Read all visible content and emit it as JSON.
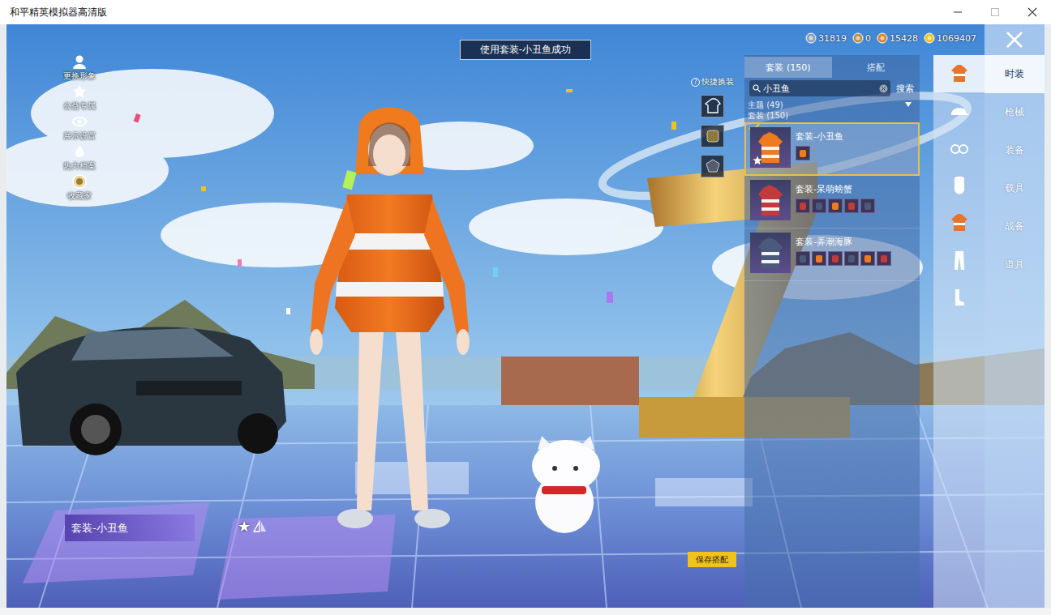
{
  "window": {
    "title": "和平精英模拟器高清版"
  },
  "toast": "使用套装-小丑鱼成功",
  "side_menu": [
    {
      "label": "更换形象"
    },
    {
      "label": "公益专属"
    },
    {
      "label": "展示设置"
    },
    {
      "label": "热力档案"
    },
    {
      "label": "收藏家"
    }
  ],
  "currencies": [
    {
      "amount": "31819",
      "color": "#8fa3bd"
    },
    {
      "amount": "0",
      "color": "#b8934a"
    },
    {
      "amount": "15428",
      "color": "#d98a2b"
    },
    {
      "amount": "1069407",
      "color": "#f0c419"
    }
  ],
  "quick_change": {
    "help": "?",
    "label": "快捷换装"
  },
  "suit_panel": {
    "tabs": [
      {
        "label": "套装 (150)",
        "selected": true
      },
      {
        "label": "搭配",
        "selected": false
      }
    ],
    "search": {
      "value": "小丑鱼",
      "button": "搜索"
    },
    "filters": [
      "主题 (49)",
      "套装 (150)"
    ],
    "items": [
      {
        "name": "套装-小丑鱼",
        "selected": true,
        "favorite": true,
        "pieces": 1
      },
      {
        "name": "套装-呆萌螃蟹",
        "selected": false,
        "favorite": false,
        "pieces": 5
      },
      {
        "name": "套装-弄潮海豚",
        "selected": false,
        "favorite": false,
        "pieces": 6
      }
    ]
  },
  "categories": [
    {
      "selected": true
    },
    {
      "selected": false
    },
    {
      "selected": false
    },
    {
      "selected": false
    },
    {
      "selected": false
    },
    {
      "selected": false
    },
    {
      "selected": false
    }
  ],
  "main_tabs": [
    {
      "label": "时装",
      "selected": true
    },
    {
      "label": "枪械",
      "selected": false
    },
    {
      "label": "装备",
      "selected": false
    },
    {
      "label": "载具",
      "selected": false
    },
    {
      "label": "战备",
      "selected": false
    },
    {
      "label": "道具",
      "selected": false
    }
  ],
  "outfit_label": {
    "name": "套装-小丑鱼",
    "star": "★"
  },
  "save_button": "保存搭配"
}
